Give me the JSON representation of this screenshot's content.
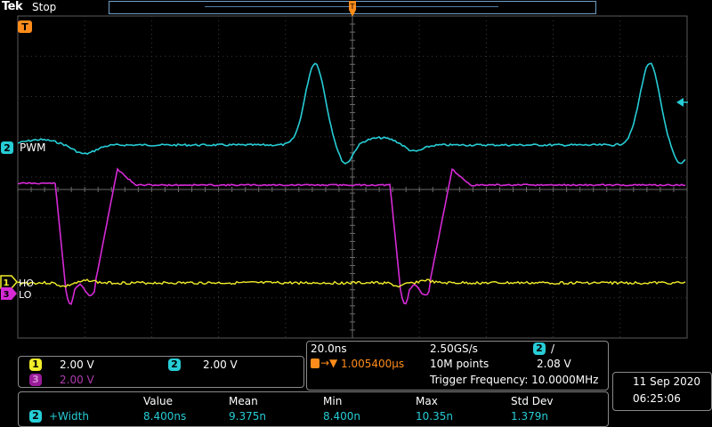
{
  "header": {
    "brand": "Tek",
    "acq_state": "Stop"
  },
  "markers": {
    "trigger_marker": "T",
    "ch1_marker": "1",
    "ch3_marker": "3",
    "ch2_marker": "2"
  },
  "channels": {
    "ch2_label": "PWM",
    "ch1_label": "HO",
    "ch3_label": "LO"
  },
  "colors": {
    "ch1": "#f2ee2a",
    "ch2": "#27cdd6",
    "ch3": "#d62ad6",
    "trigger": "#ff8c1a",
    "grid": "#4a4a4a"
  },
  "vertical": {
    "ch1": {
      "num": "1",
      "scale": "2.00 V"
    },
    "ch2": {
      "num": "2",
      "scale": "2.00 V"
    },
    "ch3": {
      "num": "3",
      "scale": "2.00 V"
    }
  },
  "acquisition": {
    "time_div": "20.0ns",
    "sample_rate": "2.50GS/s",
    "trig_source": "2",
    "trig_slope": "/",
    "trig_position": "1.005400µs",
    "record_length": "10M points",
    "trig_level": "2.08 V",
    "trig_freq": "Trigger Frequency: 10.0000MHz"
  },
  "datetime": {
    "date": "11 Sep 2020",
    "time": "06:25:06"
  },
  "measurement": {
    "source": "2",
    "name": "+Width",
    "headers": [
      "Value",
      "Mean",
      "Min",
      "Max",
      "Std Dev"
    ],
    "values": [
      "8.400ns",
      "9.375n",
      "8.400n",
      "10.35n",
      "1.379n"
    ]
  }
}
